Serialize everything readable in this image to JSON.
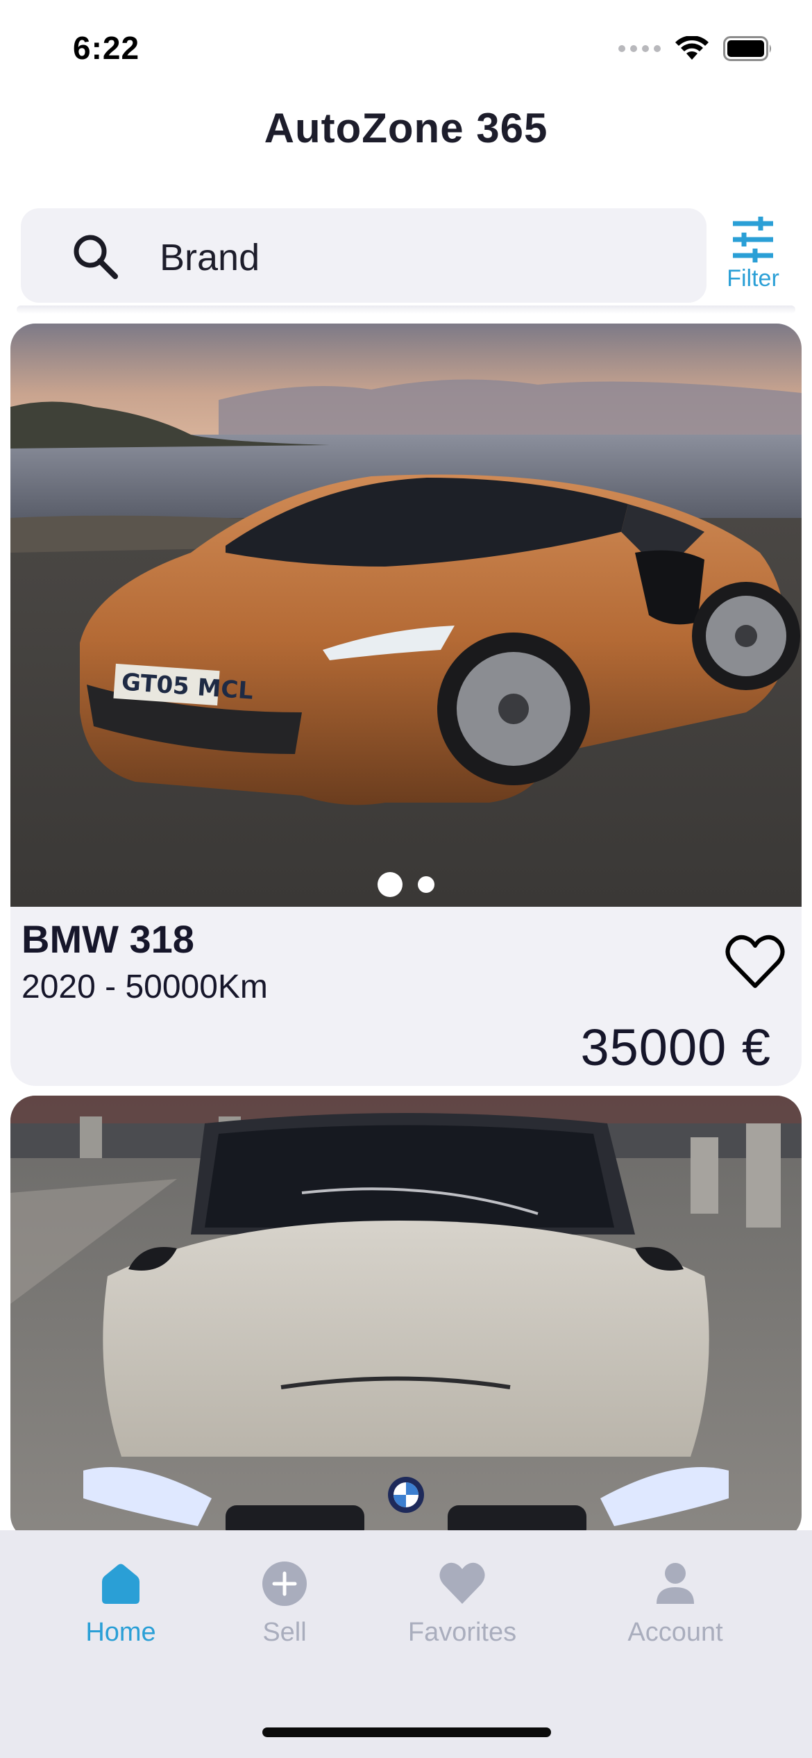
{
  "status_bar": {
    "time": "6:22"
  },
  "app": {
    "title": "AutoZone 365"
  },
  "search": {
    "placeholder": "Brand",
    "filter_label": "Filter"
  },
  "listings": [
    {
      "title": "BMW 318",
      "subtitle": "2020 - 50000Km",
      "price": "35000 €",
      "photo": "orange-sports-car-icon",
      "carousel": {
        "current": 1,
        "total": 2
      }
    },
    {
      "photo": "white-bmw-front-icon"
    }
  ],
  "tabs": [
    {
      "label": "Home",
      "icon": "home-icon",
      "active": true
    },
    {
      "label": "Sell",
      "icon": "plus-circle-icon",
      "active": false
    },
    {
      "label": "Favorites",
      "icon": "heart-icon",
      "active": false
    },
    {
      "label": "Account",
      "icon": "person-icon",
      "active": false
    }
  ],
  "colors": {
    "accent": "#2a9fd6",
    "inactive_tab": "#a9adbd",
    "card_bg": "#f1f1f6",
    "tab_bar_bg": "#e9e9f0"
  }
}
